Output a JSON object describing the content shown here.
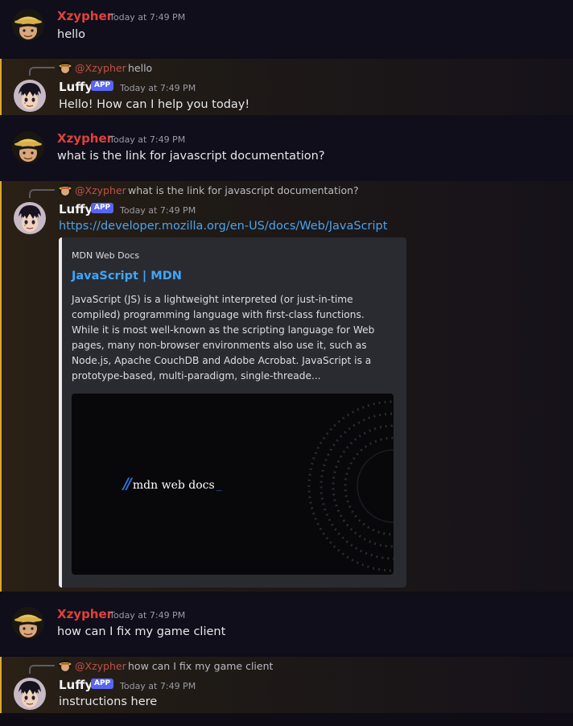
{
  "messages": [
    {
      "username": "Xzypher",
      "timestamp": "Today at 7:49 PM",
      "text": "hello"
    },
    {
      "reply": {
        "mention": "@Xzypher",
        "text": "hello"
      },
      "username": "Luffy",
      "badge": "APP",
      "timestamp": "Today at 7:49 PM",
      "text": "Hello! How can I help  you today!"
    },
    {
      "username": "Xzypher",
      "timestamp": "Today at 7:49 PM",
      "text": "what is the link for javascript documentation?"
    },
    {
      "reply": {
        "mention": "@Xzypher",
        "text": "what is the link for javascript documentation?"
      },
      "username": "Luffy",
      "badge": "APP",
      "timestamp": "Today at 7:49 PM",
      "link": "https://developer.mozilla.org/en-US/docs/Web/JavaScript",
      "embed": {
        "provider": "MDN Web Docs",
        "title": "JavaScript | MDN",
        "description": "JavaScript (JS) is a lightweight interpreted (or just-in-time compiled) programming language with first-class functions. While it is most well-known as the scripting language for Web pages, many non-browser environments also use it, such as Node.js, Apache CouchDB and Adobe Acrobat. JavaScript is a prototype-based, multi-paradigm, single-threade...",
        "image_logo_text": "mdn web docs"
      }
    },
    {
      "username": "Xzypher",
      "timestamp": "Today at 7:49 PM",
      "text": "how can I fix my game client"
    },
    {
      "reply": {
        "mention": "@Xzypher",
        "text": "how can I fix my game client"
      },
      "username": "Luffy",
      "badge": "APP",
      "timestamp": "Today at 7:49 PM",
      "text": "instructions here"
    }
  ],
  "colors": {
    "xzypher_name": "#e0413c",
    "app_badge": "#5865f2",
    "link": "#4aa3f0",
    "highlight_bar": "#d9a72b"
  }
}
